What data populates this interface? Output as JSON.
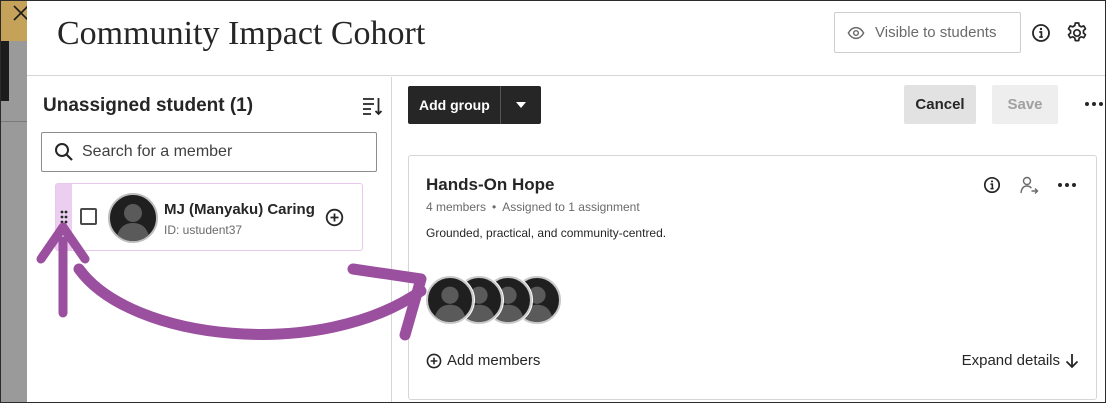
{
  "window": {
    "title": "Community Impact Cohort",
    "close_icon": "close-icon"
  },
  "header": {
    "visibility_label": "Visible to students",
    "visibility_icon": "eye-icon",
    "info_icon": "info-icon",
    "settings_icon": "gear-icon"
  },
  "unassigned": {
    "title": "Unassigned student (1)",
    "sort_icon": "sort-icon",
    "search_placeholder": "Search for a member",
    "members": [
      {
        "name": "MJ (Manyaku) Caring",
        "id": "ID: ustudent37"
      }
    ]
  },
  "toolbar": {
    "add_group_label": "Add group",
    "cancel_label": "Cancel",
    "save_label": "Save"
  },
  "groups": [
    {
      "name": "Hands-On Hope",
      "members_count": "4 members",
      "assigned": "Assigned to 1 assignment",
      "description": "Grounded, practical, and community-centred.",
      "add_members_label": "Add members",
      "expand_label": "Expand details"
    }
  ],
  "colors": {
    "accent_purple": "#9b4f9f",
    "drag_highlight": "#eccff0",
    "dark_button": "#262626",
    "gold": "#c4a25a"
  }
}
